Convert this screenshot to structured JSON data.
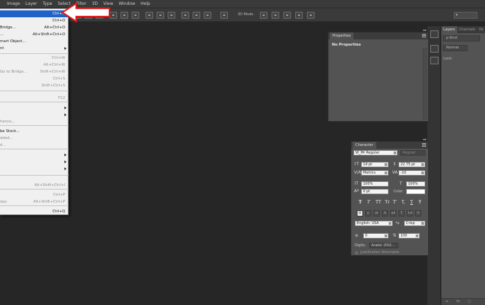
{
  "menubar": {
    "items": [
      "Image",
      "Layer",
      "Type",
      "Select",
      "Filter",
      "3D",
      "View",
      "Window",
      "Help"
    ]
  },
  "options_bar": {
    "mode_3d_label": "3D Mode:"
  },
  "file_menu": {
    "items": [
      {
        "label": "",
        "shortcut": "Ctrl+N",
        "state": "selected"
      },
      {
        "label": "",
        "shortcut": "Ctrl+O"
      },
      {
        "label": "Bridge...",
        "shortcut": "Alt+Ctrl+O"
      },
      {
        "label": "...",
        "shortcut": "Alt+Shift+Ctrl+O"
      },
      {
        "label": "mart Object...",
        "shortcut": ""
      },
      {
        "label": "nt",
        "shortcut": "",
        "submenu": true
      },
      {
        "label": "",
        "shortcut": "Ctrl+W",
        "state": "disabled"
      },
      {
        "label": "",
        "shortcut": "Alt+Ctrl+W",
        "state": "disabled"
      },
      {
        "label": "Go to Bridge...",
        "shortcut": "Shift+Ctrl+W",
        "state": "disabled"
      },
      {
        "label": "",
        "shortcut": "Ctrl+S",
        "state": "disabled"
      },
      {
        "label": "",
        "shortcut": "Shift+Ctrl+S",
        "state": "disabled"
      },
      {
        "label": "",
        "shortcut": "F12",
        "state": "disabled"
      },
      {
        "label": "",
        "shortcut": "",
        "submenu": true
      },
      {
        "label": "",
        "shortcut": "",
        "submenu": true
      },
      {
        "label": "hance...",
        "shortcut": "",
        "state": "disabled"
      },
      {
        "label": "be Stock...",
        "shortcut": ""
      },
      {
        "label": "dded...",
        "shortcut": "",
        "state": "disabled"
      },
      {
        "label": "d...",
        "shortcut": "",
        "state": "disabled"
      },
      {
        "label": "",
        "shortcut": "",
        "submenu": true
      },
      {
        "label": "",
        "shortcut": "",
        "submenu": true
      },
      {
        "label": "",
        "shortcut": "",
        "submenu": true
      },
      {
        "label": "",
        "shortcut": "Alt+Shift+Ctrl+I",
        "state": "disabled"
      },
      {
        "label": "",
        "shortcut": "Ctrl+P",
        "state": "disabled"
      },
      {
        "label": "opy",
        "shortcut": "Alt+Shift+Ctrl+P",
        "state": "disabled"
      },
      {
        "label": "",
        "shortcut": "Ctrl+Q"
      }
    ]
  },
  "layers_panel": {
    "tabs": [
      "Layers",
      "Channels",
      "Pa"
    ],
    "filter_label": "ρ Kind",
    "blend_mode": "Normal",
    "lock_label": "Lock:",
    "bottom_icons": [
      "⇔",
      "fx",
      "▢"
    ]
  },
  "properties_panel": {
    "title": "Properties",
    "empty_text": "No Properties"
  },
  "character_panel": {
    "title": "Character",
    "font_family": "W_Mr Regular",
    "font_style": "Regular",
    "font_size": "14 pt",
    "leading": "22.75 pt",
    "kerning": "Metrics",
    "tracking": "-10",
    "vertical_scale": "100%",
    "horizontal_scale": "100%",
    "baseline_shift": "0 pt",
    "color_label": "Color:",
    "type_style_buttons": [
      "T",
      "T",
      "TT",
      "Tr",
      "T'",
      "T,",
      "T",
      "Ŧ"
    ],
    "opentype_buttons": [
      "fi",
      "ɕ",
      "st",
      "A",
      "ad",
      "T",
      "1st",
      "½"
    ],
    "language": "English: USA",
    "aa_label": "ªa",
    "antialias": "Crisp",
    "indent_value": "0",
    "percent_value": "100",
    "digits_label": "Digits:",
    "digits_value": "Arabic (002...",
    "justification_label": "Justification Alternates"
  }
}
